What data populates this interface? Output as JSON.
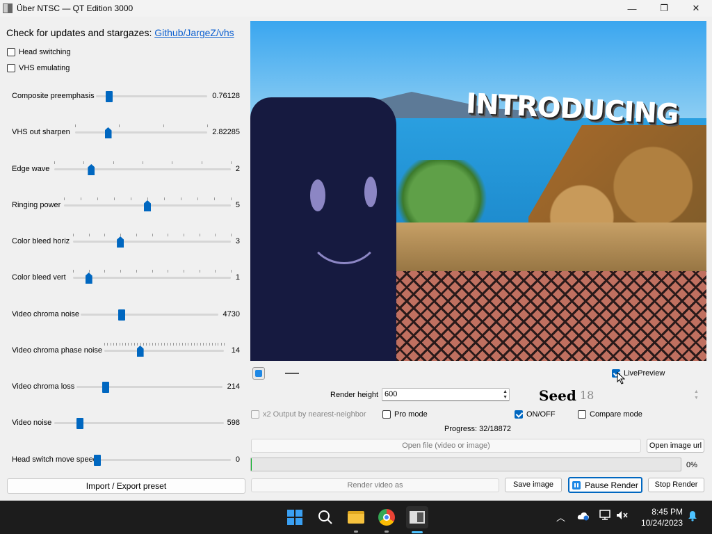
{
  "window": {
    "title": "Über NTSC — QT Edition 3000",
    "min_glyph": "—",
    "max_glyph": "❐",
    "close_glyph": "✕"
  },
  "header": {
    "updates_text": "Check for updates and stargazes: ",
    "link_text": "Github/JargeZ/vhs"
  },
  "checkboxes": {
    "head_switching": {
      "label": "Head switching",
      "checked": false
    },
    "vhs_emulating": {
      "label": "VHS emulating",
      "checked": false
    }
  },
  "sliders": [
    {
      "label": "Composite preemphasis",
      "value": "0.76128",
      "fraction": 0.12
    },
    {
      "label": "VHS out sharpen",
      "value": "2.82285",
      "fraction": 0.25
    },
    {
      "label": "Edge wave",
      "value": "2",
      "fraction": 0.21
    },
    {
      "label": "Ringing power",
      "value": "5",
      "fraction": 0.5
    },
    {
      "label": "Color bleed horiz",
      "value": "3",
      "fraction": 0.3
    },
    {
      "label": "Color bleed vert",
      "value": "1",
      "fraction": 0.1
    },
    {
      "label": "Video chroma noise",
      "value": "4730",
      "fraction": 0.3
    },
    {
      "label": "Video chroma phase noise",
      "value": "14",
      "fraction": 0.3
    },
    {
      "label": "Video chroma loss",
      "value": "214",
      "fraction": 0.2
    },
    {
      "label": "Video noise",
      "value": "598",
      "fraction": 0.15
    },
    {
      "label": "Head switch move speed",
      "value": "0",
      "fraction": 0.0
    }
  ],
  "import_export_label": "Import / Export preset",
  "preview_overlay_text": "INTRODUCING",
  "live_preview": {
    "label": "LivePreview",
    "checked": true
  },
  "render_height": {
    "label": "Render height",
    "value": "600"
  },
  "seed": {
    "label": "Seed",
    "value": "18"
  },
  "options": {
    "x2_output": {
      "label": "x2 Output by nearest-neighbor",
      "checked": false,
      "disabled": true
    },
    "pro_mode": {
      "label": "Pro mode",
      "checked": false
    },
    "on_off": {
      "label": "ON/OFF",
      "checked": true
    },
    "compare_mode": {
      "label": "Compare mode",
      "checked": false
    }
  },
  "progress": {
    "text": "Progress: 32/18872",
    "percent_label": "0%",
    "fraction": 0.0017
  },
  "buttons": {
    "open_file": "Open file (video or image)",
    "open_image_url": "Open image url",
    "render_video_as": "Render video as",
    "save_image": "Save image",
    "pause_render": "Pause Render",
    "stop_render": "Stop Render"
  },
  "taskbar": {
    "time": "8:45 PM",
    "date": "10/24/2023"
  },
  "colors": {
    "accent": "#0067c0",
    "link": "#0b5fd0",
    "progress": "#06b025"
  }
}
